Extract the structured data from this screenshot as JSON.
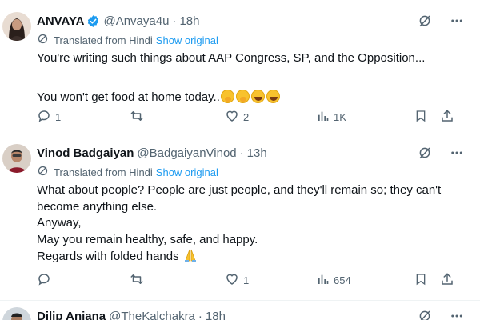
{
  "colors": {
    "accent": "#1d9bf0",
    "secondary_text": "#536471",
    "primary_text": "#0f1419",
    "divider": "#eff3f4"
  },
  "tweets": [
    {
      "name": "ANVAYA",
      "verified": true,
      "handle": "@Anvaya4u",
      "separator": "·",
      "time": "18h",
      "translated_label": "Translated from Hindi",
      "show_original": "Show original",
      "lines": [
        "You're writing such things about AAP Congress, SP, and the Opposition...",
        "",
        "You won't get food at home today.."
      ],
      "emojis": [
        "hand-over-mouth-emoji",
        "hand-over-mouth-emoji",
        "grinning-emoji",
        "grinning-emoji"
      ],
      "replies": "1",
      "retweets": "",
      "likes": "2",
      "views": "1K"
    },
    {
      "name": "Vinod Badgaiyan",
      "verified": false,
      "handle": "@BadgaiyanVinod",
      "separator": "·",
      "time": "13h",
      "translated_label": "Translated from Hindi",
      "show_original": "Show original",
      "lines": [
        "What about people? People are just people, and they'll remain so; they can't",
        "become anything else.",
        "Anyway,",
        "May you remain healthy, safe, and happy.",
        "Regards with folded hands"
      ],
      "emojis": [
        "folded-hands-emoji"
      ],
      "replies": "",
      "retweets": "",
      "likes": "1",
      "views": "654"
    },
    {
      "name": "Dilip Anjana",
      "handle": "@TheKalchakra",
      "separator": "·",
      "time": "18h"
    }
  ]
}
